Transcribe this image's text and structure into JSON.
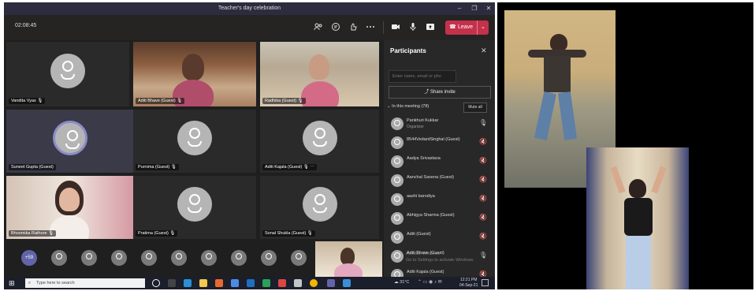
{
  "window": {
    "title": "Teacher's day celebration",
    "controls": [
      "–",
      "❐",
      "✕"
    ]
  },
  "toolbar": {
    "timer": "02:08:45",
    "leave_label": "Leave",
    "icons": [
      "people-icon",
      "chat-icon",
      "reactions-icon",
      "more-icon",
      "camera-icon",
      "mic-icon",
      "share-screen-icon"
    ]
  },
  "tiles": [
    {
      "name": "Vandita Vyas"
    },
    {
      "name": "Aditi Bhave (Guest)"
    },
    {
      "name": "Radhika (Guest)"
    },
    {
      "name": "Suneet Gupta (Guest)"
    },
    {
      "name": "Purnima (Guest)"
    },
    {
      "name": "Aditi Kajala (Guest)"
    },
    {
      "name": "Bhoomika Rathore"
    },
    {
      "name": "Pratima (Guest)"
    },
    {
      "name": "Sonal Shukla (Guest)"
    }
  ],
  "strip": {
    "overflow_count": "+59"
  },
  "panel": {
    "title": "Participants",
    "search_placeholder": "Enter name, email or pho",
    "share_label": "Share invite",
    "section_label": "In this meeting (78)",
    "mute_all_label": "Mute all",
    "participants": [
      {
        "name": "Pankhuri Kukkar",
        "sub": "Organizer"
      },
      {
        "name": "8544VedantSinghal (Guest)"
      },
      {
        "name": "Aadya Srivastava"
      },
      {
        "name": "Aanchal Saxena (Guest)"
      },
      {
        "name": "aashi barodiya"
      },
      {
        "name": "Abhigya Sharma (Guest)"
      },
      {
        "name": "Aditi (Guest)"
      },
      {
        "name": "Aditi Bhave (Guest)"
      },
      {
        "name": "Aditi Kajala (Guest)"
      }
    ]
  },
  "watermark": {
    "line1": "Activate Windows",
    "line2": "Go to Settings to activate Windows."
  },
  "taskbar": {
    "search_placeholder": "Type here to search",
    "weather": "31°C",
    "time": "12:21 PM",
    "date": "04-Sep-21"
  }
}
